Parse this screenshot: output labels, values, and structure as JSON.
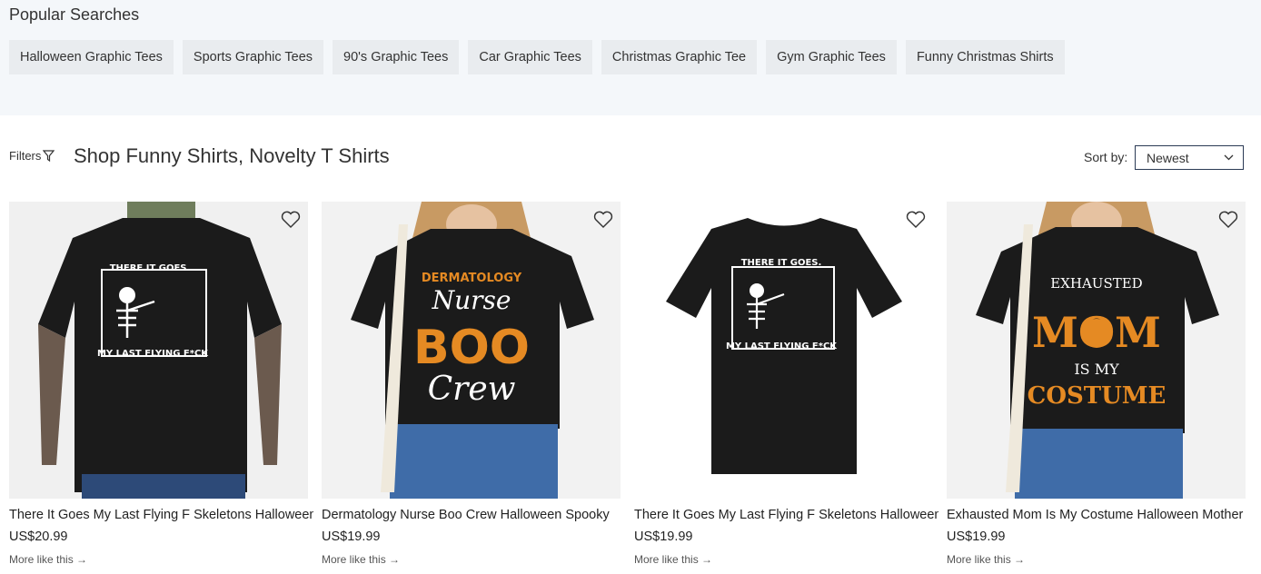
{
  "popular": {
    "title": "Popular Searches",
    "chips": [
      "Halloween Graphic Tees",
      "Sports Graphic Tees",
      "90's Graphic Tees",
      "Car Graphic Tees",
      "Christmas Graphic Tee",
      "Gym Graphic Tees",
      "Funny Christmas Shirts"
    ]
  },
  "toolbar": {
    "filters_label": "Filters",
    "page_title": "Shop Funny Shirts, Novelty T Shirts",
    "sort_label": "Sort by:",
    "sort_value": "Newest"
  },
  "products": [
    {
      "name": "There It Goes My Last Flying F Skeletons Halloween",
      "price": "US$20.99",
      "more": "More like this →",
      "shirt_lines": [
        "THERE IT GOES.",
        "MY LAST FLYING F*CK"
      ]
    },
    {
      "name": "Dermatology Nurse Boo Crew Halloween Spooky",
      "price": "US$19.99",
      "more": "More like this →",
      "shirt_lines": [
        "DERMATOLOGY",
        "Nurse",
        "BOO",
        "Crew"
      ]
    },
    {
      "name": "There It Goes My Last Flying F Skeletons Halloween",
      "price": "US$19.99",
      "more": "More like this →",
      "shirt_lines": [
        "THERE IT GOES.",
        "MY LAST FLYING F*CK"
      ]
    },
    {
      "name": "Exhausted Mom Is My Costume Halloween Mother",
      "price": "US$19.99",
      "more": "More like this →",
      "shirt_lines": [
        "EXHAUSTED",
        "MOM",
        "IS MY",
        "COSTUME"
      ]
    }
  ],
  "colors": {
    "popular_bg": "#f4f7fa",
    "chip_bg": "#e9ecef",
    "select_border": "#2b3a55",
    "shirt": "#1b1b1b",
    "orange": "#e58a23"
  }
}
